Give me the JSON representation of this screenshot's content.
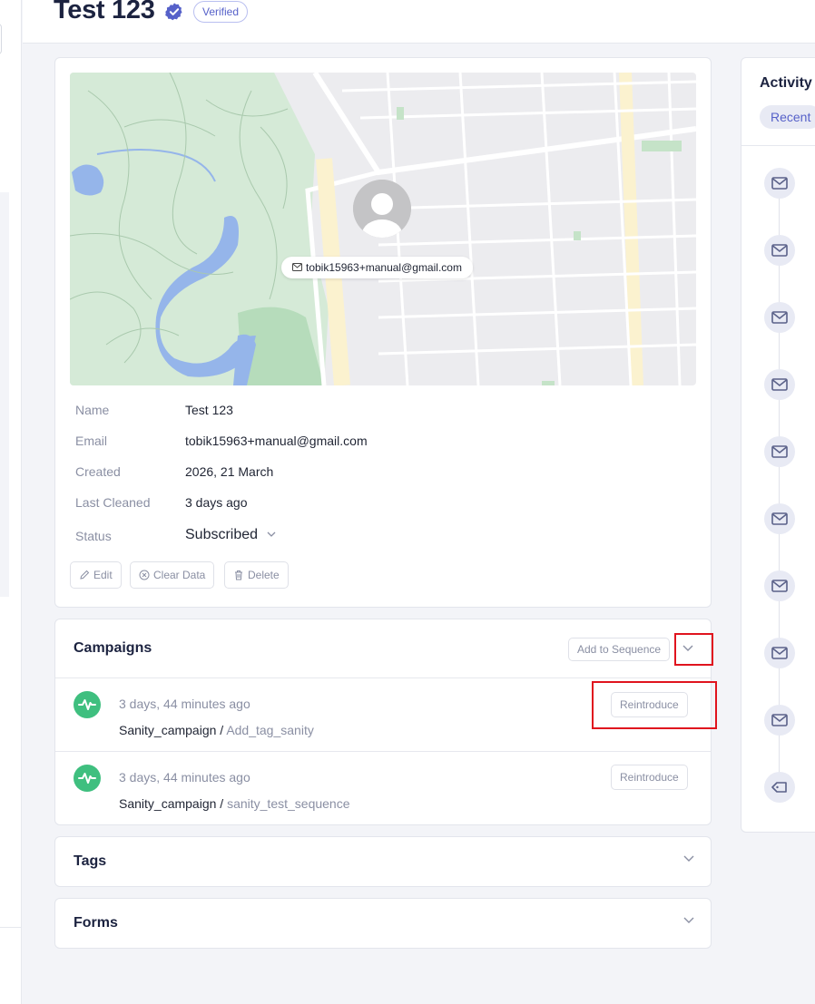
{
  "header": {
    "title": "Test 123",
    "verified_label": "Verified"
  },
  "profile": {
    "map_email": "tobik15963+manual@gmail.com",
    "fields": [
      {
        "label": "Name",
        "value": "Test 123"
      },
      {
        "label": "Email",
        "value": "tobik15963+manual@gmail.com"
      },
      {
        "label": "Created",
        "value": "2026, 21 March"
      },
      {
        "label": "Last Cleaned",
        "value": "3 days ago"
      }
    ],
    "status_label": "Status",
    "status_value": "Subscribed",
    "actions": {
      "edit": "Edit",
      "clear": "Clear Data",
      "delete": "Delete"
    }
  },
  "campaigns": {
    "title": "Campaigns",
    "add_to_sequence": "Add to Sequence",
    "items": [
      {
        "time": "3 days, 44 minutes ago",
        "campaign": "Sanity_campaign",
        "separator": " / ",
        "sequence": "Add_tag_sanity",
        "action": "Reintroduce"
      },
      {
        "time": "3 days, 44 minutes ago",
        "campaign": "Sanity_campaign",
        "separator": " / ",
        "sequence": "sanity_test_sequence",
        "action": "Reintroduce"
      }
    ]
  },
  "tags": {
    "title": "Tags"
  },
  "forms": {
    "title": "Forms"
  },
  "activity": {
    "title": "Activity",
    "tab_recent": "Recent",
    "icons": [
      "mail-icon",
      "mail-icon",
      "mail-icon",
      "mail-icon",
      "mail-icon",
      "mail-icon",
      "mail-icon",
      "mail-icon",
      "mail-icon",
      "tag-icon"
    ]
  },
  "colors": {
    "accent": "#5661c9",
    "campaign_green": "#3fbf7f",
    "highlight_red": "#e0141e"
  }
}
